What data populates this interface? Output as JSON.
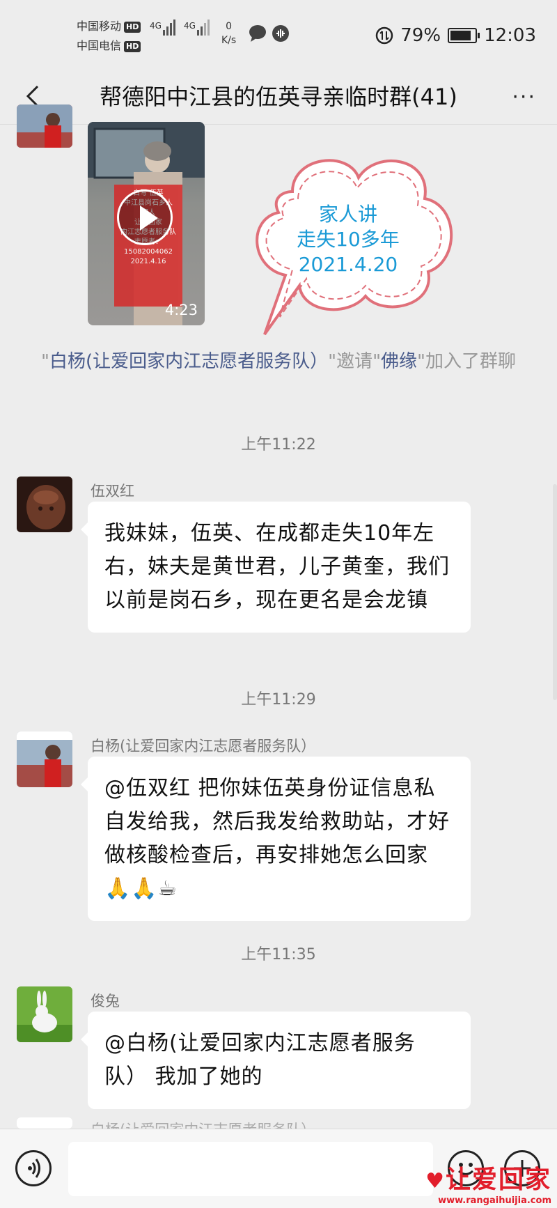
{
  "status": {
    "carrier1": "中国移动",
    "carrier2": "中国电信",
    "hd": "HD",
    "net1": "4G",
    "net2": "4G",
    "speed_value": "0",
    "speed_unit": "K/s",
    "battery": "79%",
    "time": "12:03"
  },
  "header": {
    "title": "帮德阳中江县的伍英寻亲临时群(41)",
    "more": "···"
  },
  "video": {
    "duration": "4:23",
    "caption_lines": [
      "白写  伍英",
      "中江县岗石乡人",
      "家人",
      "让爱回家",
      "内江志愿者服务队",
      "志愿者：",
      "15082004062",
      "2021.4.16"
    ]
  },
  "cloud_note": [
    "家人讲",
    "走失10多年",
    "2021.4.20"
  ],
  "system_message": {
    "q1": "\"",
    "inviter": "白杨(让爱回家内江志愿者服务队）",
    "q2": "\"邀请\"",
    "invitee": "佛缘",
    "tail": "\"加入了群聊"
  },
  "messages": [
    {
      "time": "上午11:22",
      "sender": "伍双红",
      "text": "我妹妹，伍英、在成都走失10年左右，妹夫是黄世君，儿子黄奎，我们以前是岗石乡，现在更名是会龙镇"
    },
    {
      "time": "上午11:29",
      "sender": "白杨(让爱回家内江志愿者服务队）",
      "text": "@伍双红  把你妹伍英身份证信息私自发给我，然后我发给救助站，才好做核酸检查后，再安排她怎么回家🙏🙏☕"
    },
    {
      "time": "上午11:35",
      "sender": "俊兔",
      "text": "@白杨(让爱回家内江志愿者服务队）  我加了她的"
    }
  ],
  "partial_sender": "白杨(让爱回家内江志愿者服务队）",
  "watermark": {
    "text": "让爱回家",
    "url": "www.rangaihuijia.com"
  },
  "colors": {
    "background": "#ededed",
    "bubble": "#ffffff",
    "link": "#4a5c8c",
    "cloud_border": "#e0707a",
    "cloud_text": "#1a9ad6",
    "watermark": "#e21e2b"
  }
}
